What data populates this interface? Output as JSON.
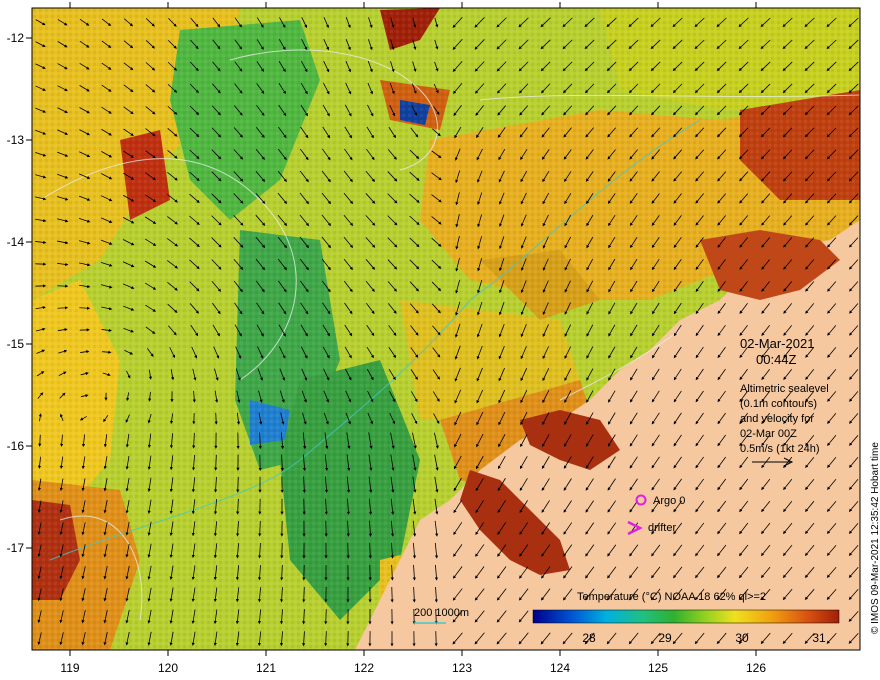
{
  "map": {
    "lon_ticks": [
      "119",
      "120",
      "121",
      "122",
      "123",
      "124",
      "125",
      "126"
    ],
    "lat_ticks": [
      "-12",
      "-13",
      "-14",
      "-15",
      "-16",
      "-17"
    ]
  },
  "info": {
    "date": "02-Mar-2021",
    "time": "00:44Z",
    "lines": [
      "Altimetric sealevel",
      "(0.1m contours)",
      "and velocity for",
      "02-Mar 00Z",
      "0.5m/s (1kt 24h)"
    ]
  },
  "markers": {
    "argo_label": "Argo 0",
    "drifter_label": "drifter",
    "marker_color": "#e020e0"
  },
  "legend": {
    "title": "Temperature (°C) NOAA 18 62% ql>=2",
    "ticks": [
      "28",
      "29",
      "30",
      "31"
    ],
    "colors": [
      "#00008b",
      "#0050d0",
      "#00b0e0",
      "#20c080",
      "#30b030",
      "#90d020",
      "#f0e020",
      "#f0a010",
      "#d85010",
      "#a02008"
    ]
  },
  "depth_legend": {
    "label": "200  1000m"
  },
  "credit": "© IMOS 09-Mar-2021 12:35:42 Hobart time",
  "colors": {
    "land": "#f5c8a0",
    "ocean_warm": "#e8a020",
    "ocean_cool": "#40a840"
  }
}
